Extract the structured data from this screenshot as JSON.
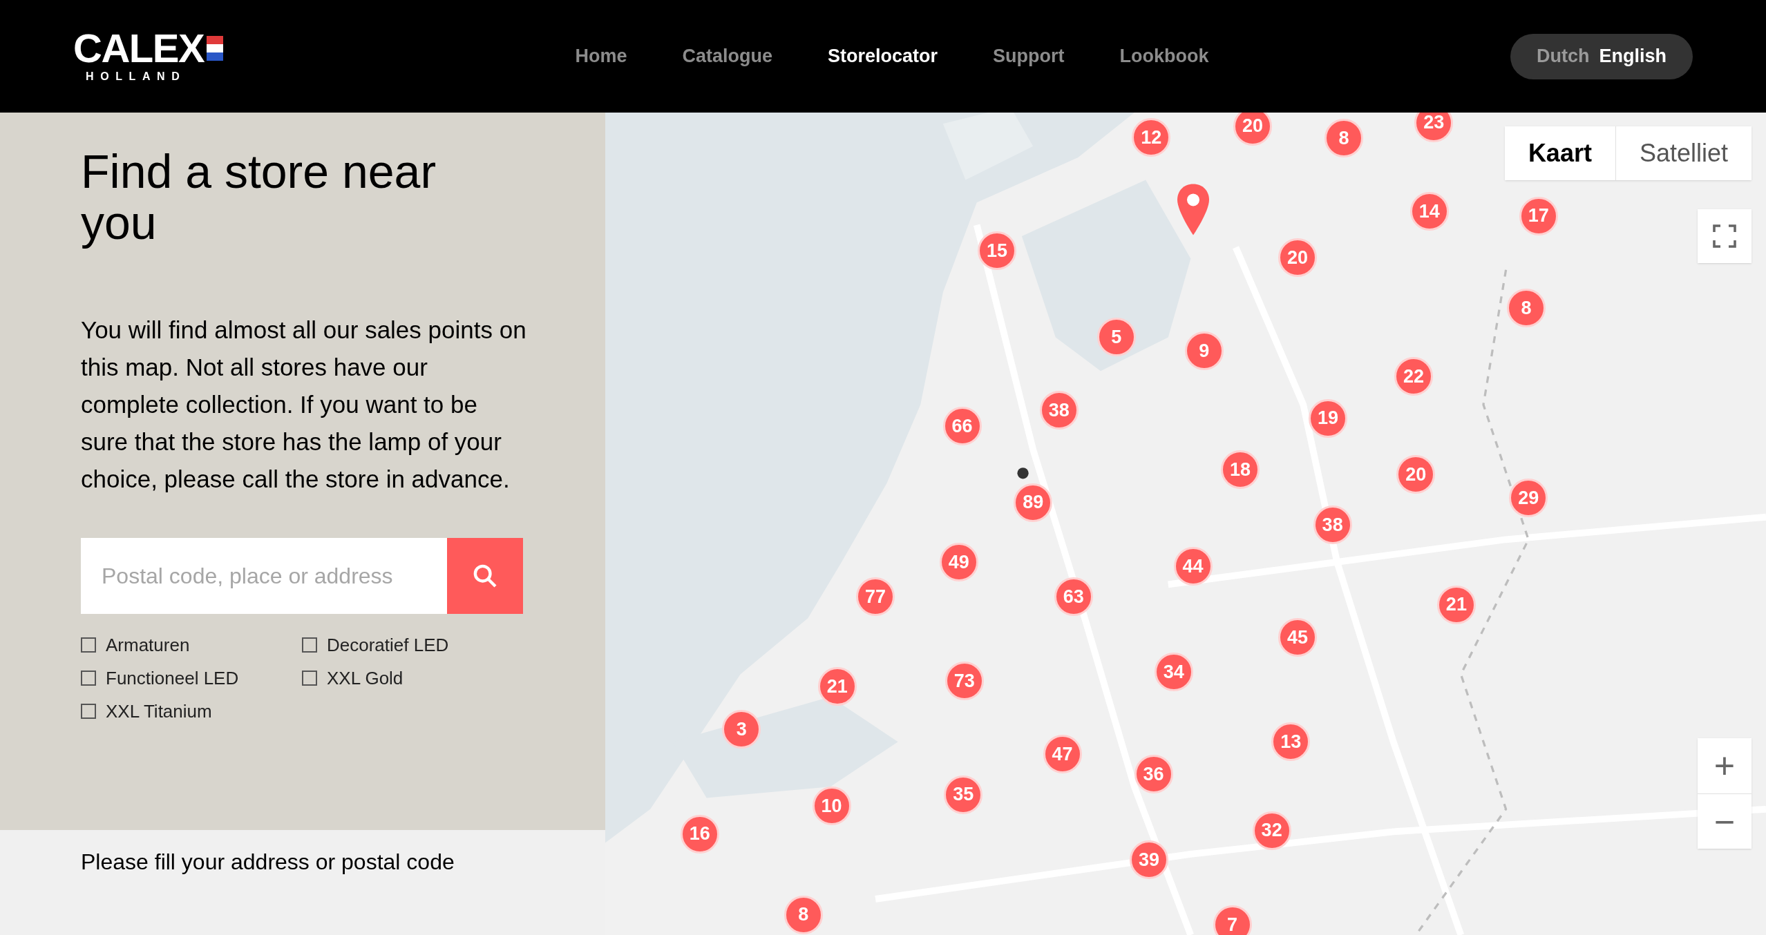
{
  "header": {
    "logo": {
      "name": "CALEX",
      "sub": "HOLLAND"
    },
    "nav": [
      {
        "label": "Home",
        "selected": false
      },
      {
        "label": "Catalogue",
        "selected": false
      },
      {
        "label": "Storelocator",
        "selected": true
      },
      {
        "label": "Support",
        "selected": false
      },
      {
        "label": "Lookbook",
        "selected": false
      }
    ],
    "languages": [
      {
        "label": "Dutch",
        "selected": false
      },
      {
        "label": "English",
        "selected": true
      }
    ]
  },
  "panel": {
    "title": "Find a store near you",
    "text": "You will find almost all our sales points on this map. Not all stores have our complete collection. If you want to be sure that the store has the lamp of your choice, please call the store in advance.",
    "search": {
      "placeholder": "Postal code, place or address"
    },
    "filters": [
      {
        "label": "Armaturen",
        "checked": false
      },
      {
        "label": "Decoratief LED",
        "checked": false
      },
      {
        "label": "Functioneel LED",
        "checked": false
      },
      {
        "label": "XXL Gold",
        "checked": false
      },
      {
        "label": "XXL Titanium",
        "checked": false
      }
    ],
    "message": "Please fill your address or postal code"
  },
  "map": {
    "kind": "picture",
    "map_types": [
      {
        "label": "Kaart",
        "selected": true
      },
      {
        "label": "Satelliet",
        "selected": false
      }
    ],
    "zoom": [
      "+",
      "−"
    ],
    "clusters": [
      "12",
      "20",
      "8",
      "23",
      "14",
      "17",
      "15",
      "20",
      "8",
      "5",
      "9",
      "22",
      "66",
      "38",
      "19",
      "18",
      "20",
      "29",
      "89",
      "38",
      "49",
      "44",
      "77",
      "63",
      "21",
      "45",
      "34",
      "73",
      "21",
      "3",
      "13",
      "47",
      "36",
      "10",
      "35",
      "32",
      "16",
      "39",
      "8",
      "7"
    ]
  }
}
